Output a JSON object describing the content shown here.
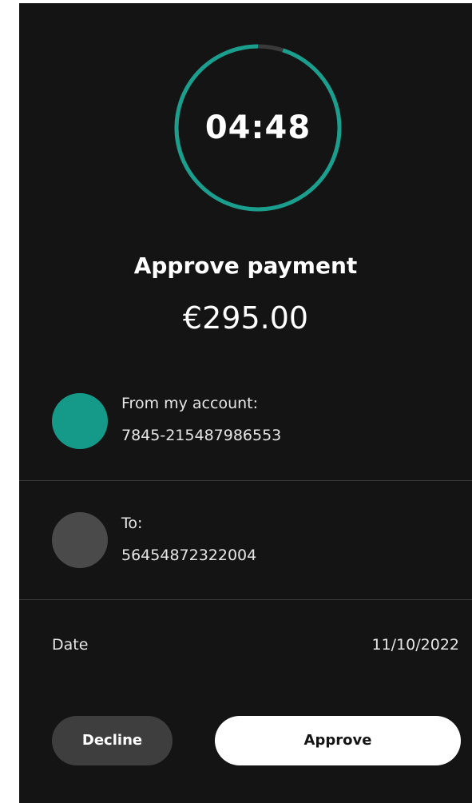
{
  "timer": {
    "value": "04:48",
    "progress": 0.95,
    "progress_color": "#1a9e8e",
    "track_color": "#3a3a3a"
  },
  "title": "Approve payment",
  "amount": "€295.00",
  "from": {
    "label": "From my account:",
    "account": "7845-215487986553",
    "avatar_color": "#159a8a"
  },
  "to": {
    "label": "To:",
    "account": "56454872322004",
    "avatar_color": "#4a4a4a"
  },
  "date": {
    "label": "Date",
    "value": "11/10/2022"
  },
  "buttons": {
    "decline": "Decline",
    "approve": "Approve"
  }
}
